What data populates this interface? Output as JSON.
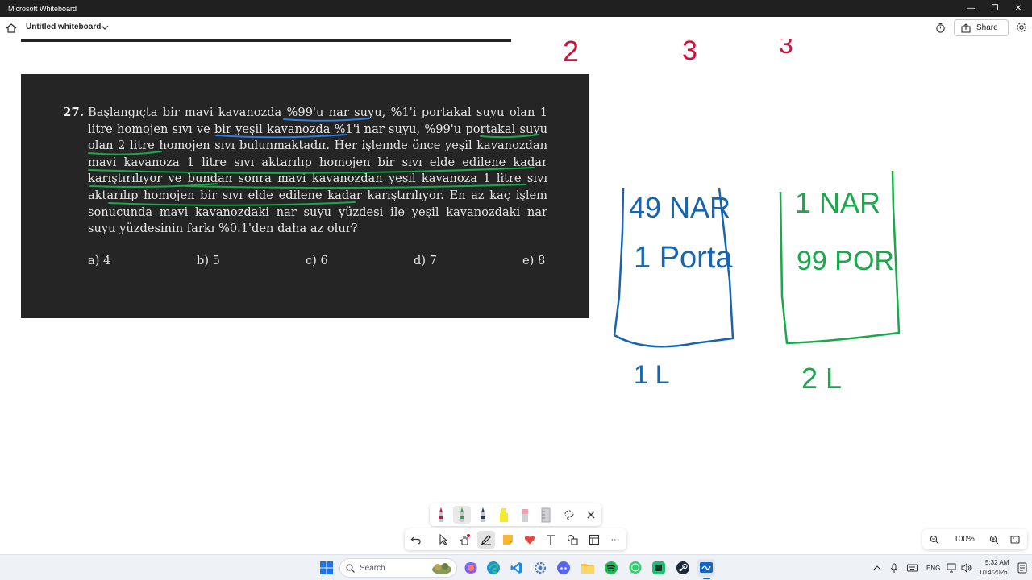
{
  "window": {
    "title": "Microsoft Whiteboard",
    "minimize": "—",
    "restore": "❐",
    "close": "✕"
  },
  "appbar": {
    "title": "Untitled whiteboard",
    "share_label": "Share"
  },
  "question": {
    "number": "27.",
    "body": "Başlangıçta bir mavi kavanozda %99'u nar suyu, %1'i portakal suyu olan 1 litre homojen sıvı ve bir yeşil kavanozda %1'i nar suyu, %99'u portakal suyu olan 2 litre homojen sıvı bulunmaktadır. Her işlemde önce yeşil kavanozdan mavi kavanoza 1 litre sıvı aktarılıp homojen bir sıvı elde edilene kadar karıştırılıyor ve bundan sonra mavi kavanozdan yeşil kavanoza 1 litre sıvı aktarılıp homojen bir sıvı elde edilene kadar karıştırılıyor. En az kaç işlem sonucunda mavi kavanozdaki nar suyu yüzdesi ile yeşil kavanozdaki nar suyu yüzdesinin farkı %0.1'den daha az olur?",
    "choices": [
      "a) 4",
      "b) 5",
      "c) 6",
      "d) 7",
      "e) 8"
    ]
  },
  "handwriting": {
    "top_digits": [
      "2",
      "3",
      "3"
    ],
    "blue_jar": {
      "line1": "49 NAR",
      "line2": "1 Porta",
      "volume": "1 L"
    },
    "green_jar": {
      "line1": "1 NAR",
      "line2": "99 POR",
      "volume": "2 L"
    }
  },
  "colors": {
    "ink_red": "#d0103a",
    "ink_blue": "#1565b0",
    "ink_green": "#19a84a",
    "underline_blue": "#2a7de1",
    "underline_green": "#1aa84a"
  },
  "pen_tray": {
    "tools": [
      "red-pen",
      "green-pen",
      "blue-pen",
      "yellow-highlighter",
      "eraser",
      "ruler",
      "lasso-select",
      "close"
    ]
  },
  "toolbar": {
    "tools": [
      "undo",
      "select",
      "touch-drawing",
      "inking",
      "sticky-note",
      "reactions",
      "text",
      "shapes",
      "templates",
      "more"
    ],
    "more_label": "···"
  },
  "zoom": {
    "level": "100%"
  },
  "taskbar": {
    "search_placeholder": "Search",
    "language": "ENG",
    "time": "5:32 AM",
    "date": "1/14/2026"
  }
}
